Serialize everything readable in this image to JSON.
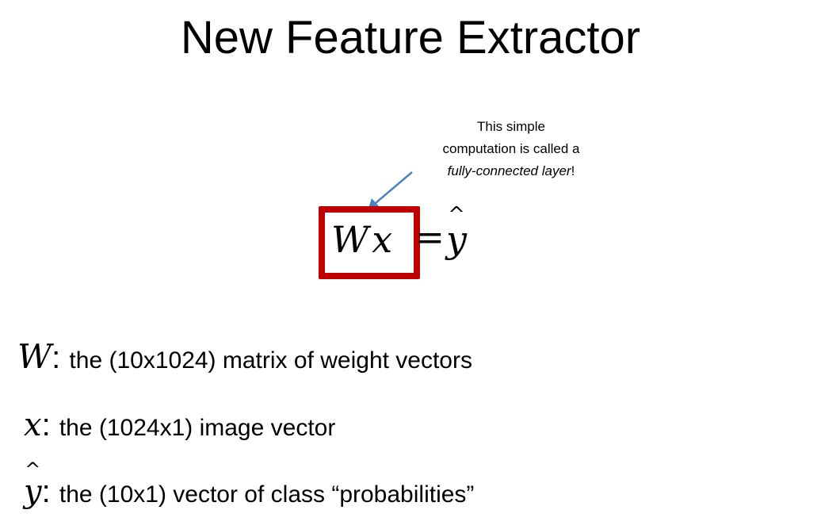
{
  "slide": {
    "title": "New Feature Extractor",
    "callout": {
      "line1": "This simple",
      "line2": "computation is called a",
      "line3_italic": "fully-connected layer",
      "line3_end": "!"
    },
    "equation": {
      "lhs": "Wx",
      "equals": "=",
      "rhs_symbol": "y",
      "rhs_hat": "^"
    },
    "definitions": [
      {
        "symbol": "W",
        "colon": ":",
        "text": "the (10x1024) matrix of weight vectors"
      },
      {
        "symbol": "x",
        "colon": ":",
        "text": "the (1024x1) image vector"
      },
      {
        "symbol": "y",
        "hat": "^",
        "colon": ":",
        "text": "the (10x1) vector of class “probabilities”"
      }
    ]
  },
  "colors": {
    "box_border": "#c00000",
    "arrow": "#4f81bd",
    "text": "#000000",
    "background": "#ffffff"
  }
}
